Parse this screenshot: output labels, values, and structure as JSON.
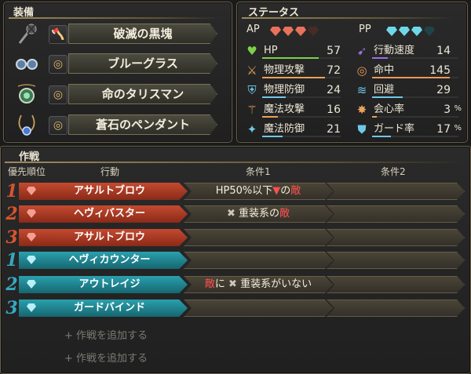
{
  "equipment": {
    "title": "装備",
    "items": [
      {
        "name": "破滅の黒塊",
        "slot_icon": "axe-icon"
      },
      {
        "name": "ブルーグラス",
        "slot_icon": "ring-icon"
      },
      {
        "name": "命のタリスマン",
        "slot_icon": "ring-icon"
      },
      {
        "name": "蒼石のペンダント",
        "slot_icon": "ring-icon"
      }
    ]
  },
  "status": {
    "title": "ステータス",
    "ap_label": "AP",
    "pp_label": "PP",
    "ap_gems": {
      "filled": 3,
      "total": 4,
      "color": "#e8725a"
    },
    "pp_gems": {
      "filled": 3,
      "total": 4,
      "color": "#6fd8e8"
    },
    "left": [
      {
        "label": "HP",
        "value": "57",
        "icon": "heart-icon",
        "color": "#7cd14a",
        "fill": 0.72
      },
      {
        "label": "物理攻撃",
        "value": "72",
        "icon": "sword-icon",
        "color": "#e8a25a",
        "fill": 0.8
      },
      {
        "label": "物理防御",
        "value": "24",
        "icon": "armor-icon",
        "color": "#6fc8e8",
        "fill": 0.3
      },
      {
        "label": "魔法攻撃",
        "value": "16",
        "icon": "staff-icon",
        "color": "#e8a25a",
        "fill": 0.2
      },
      {
        "label": "魔法防御",
        "value": "21",
        "icon": "magic-shield-icon",
        "color": "#6fc8e8",
        "fill": 0.26
      }
    ],
    "right": [
      {
        "label": "行動速度",
        "value": "14",
        "unit": "",
        "icon": "speed-icon",
        "color": "#9a70e0",
        "fill": 0.18
      },
      {
        "label": "命中",
        "value": "145",
        "unit": "",
        "icon": "target-icon",
        "color": "#e89a5a",
        "fill": 0.9
      },
      {
        "label": "回避",
        "value": "29",
        "unit": "",
        "icon": "evade-icon",
        "color": "#6fc8e8",
        "fill": 0.35
      },
      {
        "label": "会心率",
        "value": "3",
        "unit": "%",
        "icon": "critical-icon",
        "color": "#e8a25a",
        "fill": 0.05
      },
      {
        "label": "ガード率",
        "value": "17",
        "unit": "%",
        "icon": "guard-icon",
        "color": "#6fc8e8",
        "fill": 0.22
      }
    ]
  },
  "tactics": {
    "title": "作戦",
    "headers": {
      "priority": "優先順位",
      "action": "行動",
      "cond1": "条件1",
      "cond2": "条件2"
    },
    "rows": [
      {
        "num": "1",
        "type": "ap",
        "action": "アサルトブロウ",
        "cond1": {
          "pre": "HP50%以下",
          "mark": "▼",
          "mid": "の",
          "red": "敵",
          "post": ""
        },
        "cond2": ""
      },
      {
        "num": "2",
        "type": "ap",
        "action": "ヘヴィバスター",
        "cond1": {
          "pre": "",
          "mark": "✖",
          "mid": " 重装系の",
          "red": "敵",
          "post": ""
        },
        "cond2": ""
      },
      {
        "num": "3",
        "type": "ap",
        "action": "アサルトブロウ",
        "cond1": null,
        "cond2": ""
      },
      {
        "num": "1",
        "type": "pp",
        "action": "ヘヴィカウンター",
        "cond1": null,
        "cond2": ""
      },
      {
        "num": "2",
        "type": "pp",
        "action": "アウトレイジ",
        "cond1": {
          "pre": "",
          "red": "敵",
          "mid": "に ",
          "mark": "✖",
          "post": " 重装系がいない",
          "red_first": true
        },
        "cond2": ""
      },
      {
        "num": "3",
        "type": "pp",
        "action": "ガードバインド",
        "cond1": null,
        "cond2": ""
      }
    ],
    "add_label": "+ 作戦を追加する",
    "add_count": 2,
    "colors": {
      "ap": "#b0402a",
      "pp": "#1f8a98"
    }
  }
}
